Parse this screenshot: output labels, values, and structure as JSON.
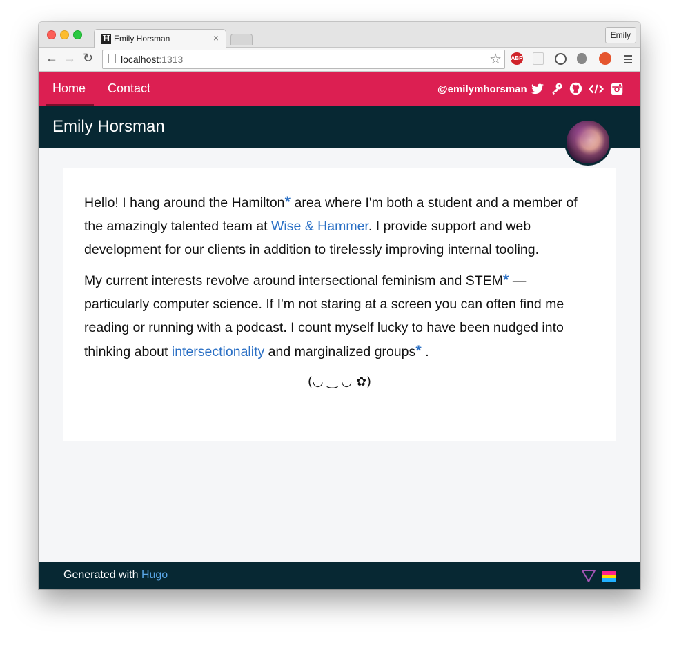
{
  "browser": {
    "tab_title": "Emily Horsman",
    "tab_favicon": "H",
    "tab_close": "×",
    "profile_name": "Emily",
    "url_host": "localhost",
    "url_port": ":1313",
    "extensions": [
      "abp-icon",
      "pocket-icon",
      "sync-icon",
      "bug-icon",
      "vivaldi-icon",
      "menu-icon"
    ],
    "ext_abp_label": "ABP"
  },
  "navbar": {
    "color": "#dc1f52",
    "items": [
      {
        "label": "Home",
        "active": true
      },
      {
        "label": "Contact",
        "active": false
      }
    ],
    "handle": "@emilymhorsman",
    "icons": [
      "twitter-icon",
      "key-icon",
      "github-icon",
      "code-icon",
      "instagram-icon"
    ]
  },
  "header": {
    "color": "#072833",
    "title": "Emily Horsman"
  },
  "content": {
    "p1": {
      "t1": "Hello! I hang around the Hamilton",
      "t2": " area where I'm both a student and a member of the amazingly talented team at ",
      "link": "Wise & Hammer",
      "t3": ". I provide support and web development for our clients in addition to tirelessly improving internal tooling."
    },
    "p2": {
      "t1": "My current interests revolve around intersectional feminism and STEM",
      "t2": " — particularly computer science. If I'm not staring at a screen you can often find me reading or running with a podcast. I count myself lucky to have been nudged into thinking about ",
      "link": "intersectionality",
      "t3": " and marginalized groups",
      "t4": " ."
    },
    "asterisk": "*",
    "kaomoji": "(◡ ‿ ◡ ✿)",
    "link_color": "#2a6fc4"
  },
  "footer": {
    "text": "Generated with ",
    "link": "Hugo",
    "flag_colors": [
      "#ff218c",
      "#ffd800",
      "#21b1ff"
    ]
  }
}
